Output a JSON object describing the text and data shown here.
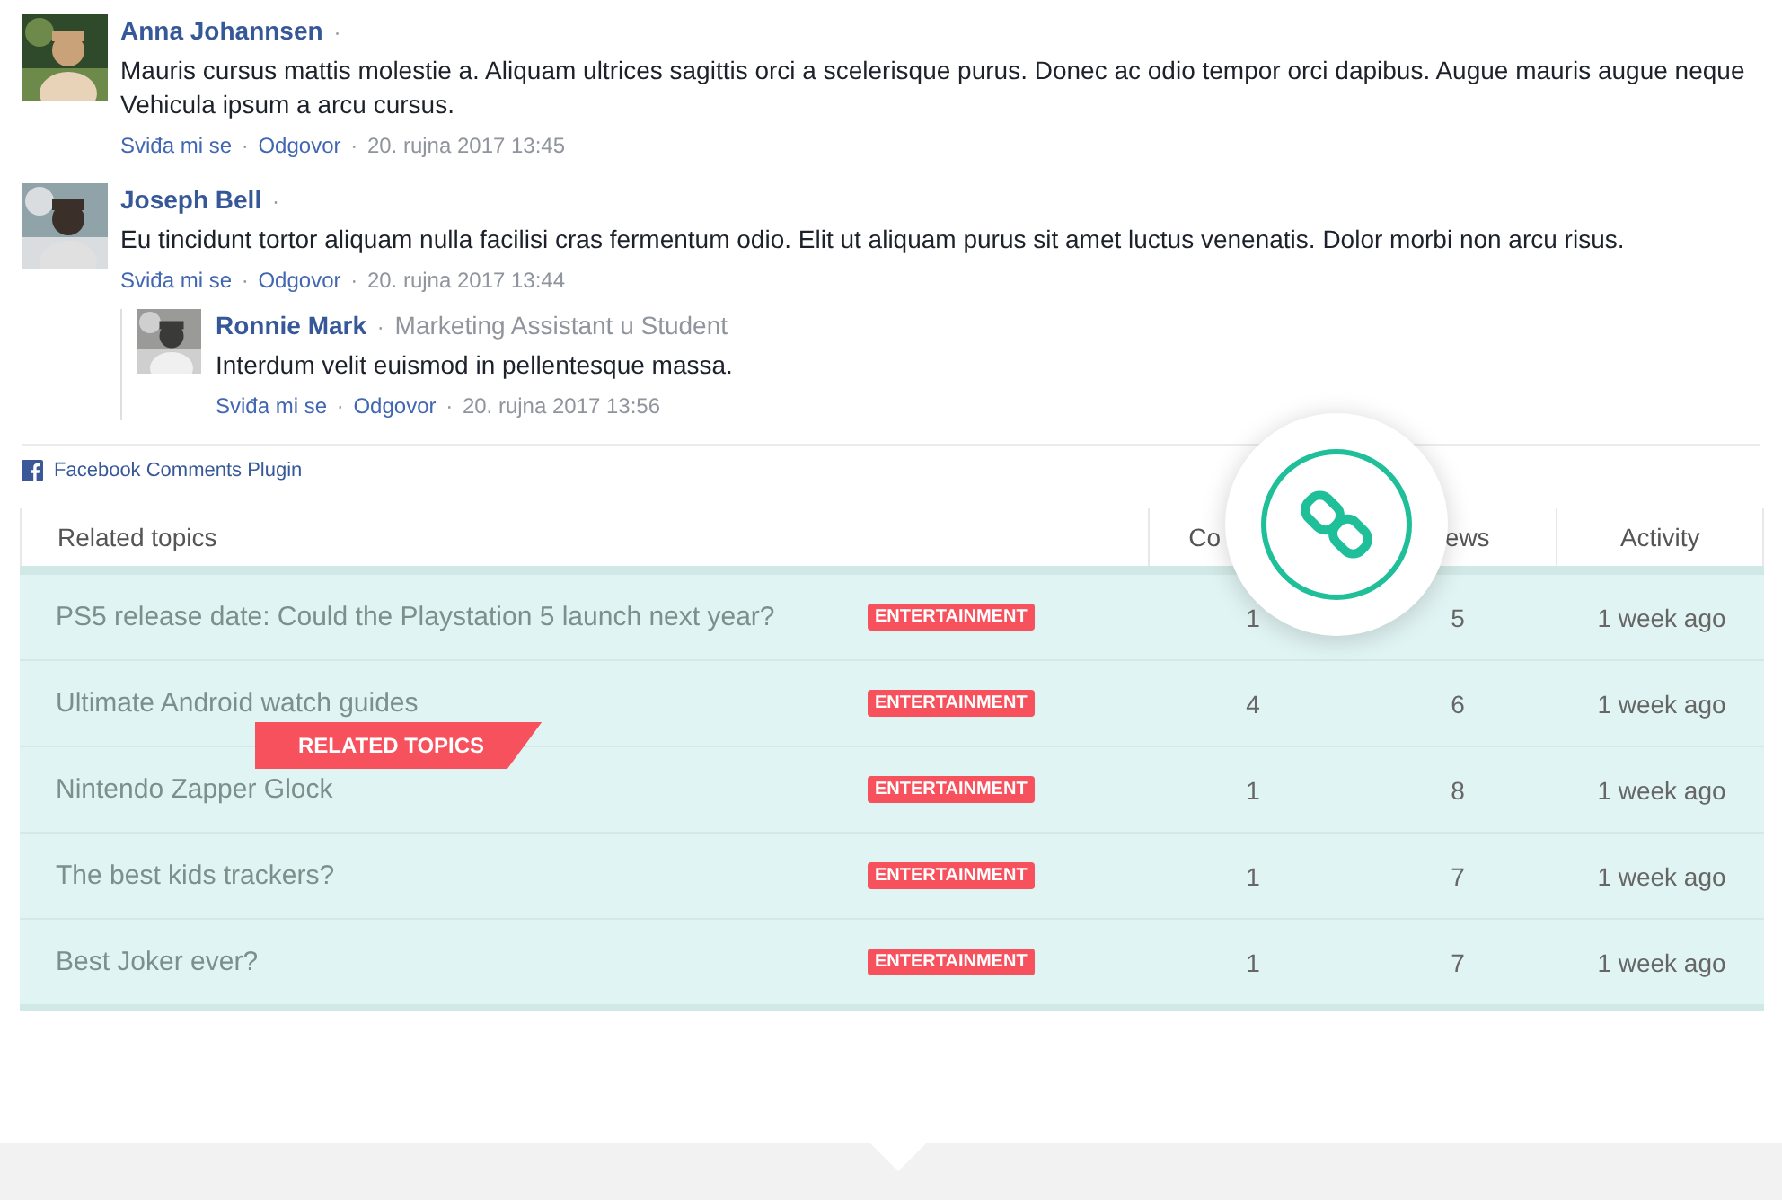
{
  "comments": [
    {
      "author": "Anna Johannsen",
      "sep": "·",
      "text": "Mauris cursus mattis molestie a. Aliquam ultrices sagittis orci a scelerisque purus. Donec ac odio tempor orci dapibus. Augue mauris augue neque Vehicula ipsum a arcu cursus.",
      "like": "Sviđa mi se",
      "sep_1": "·",
      "reply": "Odgovor",
      "sep_2": "·",
      "time": "20. rujna 2017 13:45",
      "avatar": {
        "kind": "picture"
      }
    },
    {
      "author": "Joseph Bell",
      "sep": "·",
      "text": "Eu tincidunt tortor aliquam nulla facilisi cras fermentum odio. Elit ut aliquam purus sit amet luctus venenatis. Dolor morbi non arcu risus.",
      "like": "Sviđa mi se",
      "sep_1": "·",
      "reply": "Odgovor",
      "sep_2": "·",
      "time": "20. rujna 2017 13:44",
      "avatar": {
        "kind": "picture"
      },
      "children": [
        {
          "author": "Ronnie Mark",
          "sep": "·",
          "role": "Marketing Assistant u Student",
          "text": "Interdum velit euismod in pellentesque massa.",
          "like": "Sviđa mi se",
          "sep_1": "·",
          "reply": "Odgovor",
          "sep_2": "·",
          "time": "20. rujna 2017 13:56",
          "avatar": {
            "kind": "picture"
          }
        }
      ]
    }
  ],
  "plugin_link": "Facebook Comments Plugin",
  "table": {
    "columns": [
      "Related topics",
      "",
      "Co",
      "ews",
      "Activity"
    ],
    "rows": [
      {
        "title": "PS5 release date: Could the Playstation 5 launch next year?",
        "tag": "ENTERTAINMENT",
        "comments": "1",
        "views": "5",
        "activity": "1 week ago"
      },
      {
        "title": "Ultimate Android watch guides",
        "tag": "ENTERTAINMENT",
        "comments": "4",
        "views": "6",
        "activity": "1 week ago"
      },
      {
        "title": "Nintendo Zapper Glock",
        "tag": "ENTERTAINMENT",
        "comments": "1",
        "views": "8",
        "activity": "1 week ago"
      },
      {
        "title": "The best kids trackers?",
        "tag": "ENTERTAINMENT",
        "comments": "1",
        "views": "7",
        "activity": "1 week ago"
      },
      {
        "title": "Best Joker ever?",
        "tag": "ENTERTAINMENT",
        "comments": "1",
        "views": "7",
        "activity": "1 week ago"
      }
    ]
  },
  "ribbon": "RELATED TOPICS"
}
